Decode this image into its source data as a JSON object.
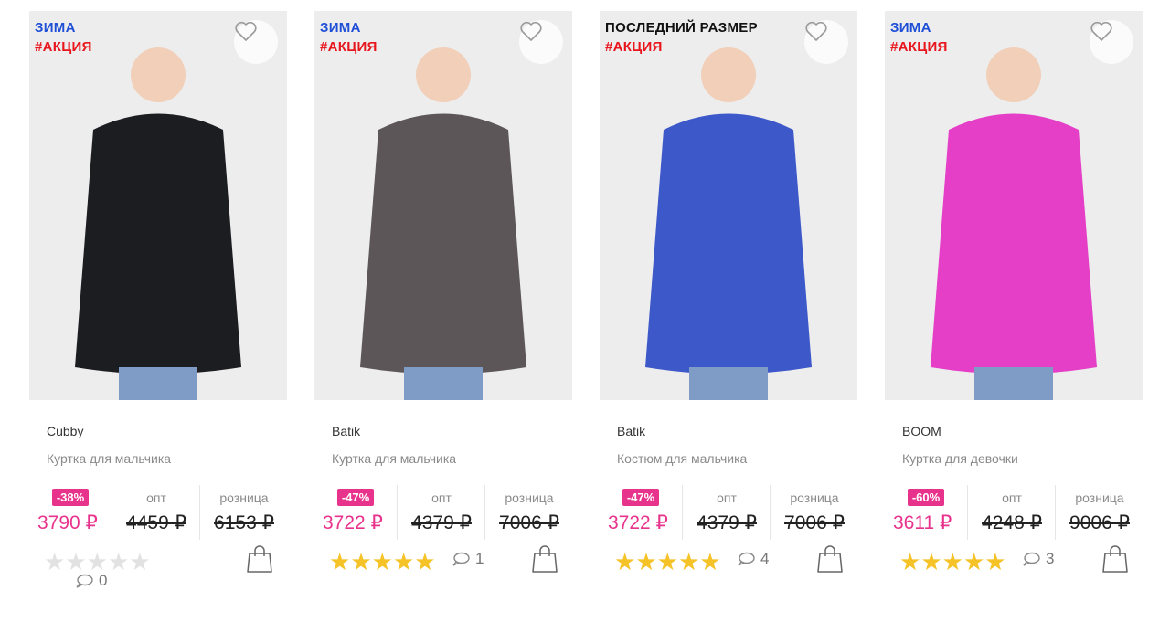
{
  "products": [
    {
      "labels": {
        "season": "ЗИМА",
        "promo": "#АКЦИЯ",
        "last": ""
      },
      "brand": "Cubby",
      "description": "Куртка для мальчика",
      "discount": "-38%",
      "price_now": "3790 ₽",
      "wholesale_label": "опт",
      "wholesale_price": "4459 ₽",
      "retail_label": "розница",
      "retail_price": "6153 ₽",
      "rating": 0,
      "comments": "0",
      "garment_color": "#1c1d20"
    },
    {
      "labels": {
        "season": "ЗИМА",
        "promo": "#АКЦИЯ",
        "last": ""
      },
      "brand": "Batik",
      "description": "Куртка для мальчика",
      "discount": "-47%",
      "price_now": "3722 ₽",
      "wholesale_label": "опт",
      "wholesale_price": "4379 ₽",
      "retail_label": "розница",
      "retail_price": "7006 ₽",
      "rating": 5,
      "comments": "1",
      "garment_color": "#5c5658"
    },
    {
      "labels": {
        "season": "",
        "promo": "#АКЦИЯ",
        "last": "ПОСЛЕДНИЙ РАЗМЕР"
      },
      "brand": "Batik",
      "description": "Костюм для мальчика",
      "discount": "-47%",
      "price_now": "3722 ₽",
      "wholesale_label": "опт",
      "wholesale_price": "4379 ₽",
      "retail_label": "розница",
      "retail_price": "7006 ₽",
      "rating": 5,
      "comments": "4",
      "garment_color": "#3d58c9"
    },
    {
      "labels": {
        "season": "ЗИМА",
        "promo": "#АКЦИЯ",
        "last": ""
      },
      "brand": "BOOM",
      "description": "Куртка для девочки",
      "discount": "-60%",
      "price_now": "3611 ₽",
      "wholesale_label": "опт",
      "wholesale_price": "4248 ₽",
      "retail_label": "розница",
      "retail_price": "9006 ₽",
      "rating": 5,
      "comments": "3",
      "garment_color": "#e43fc6"
    }
  ],
  "colors": {
    "accent_pink": "#e8338c",
    "promo_red": "#e8161d",
    "season_blue": "#1e4fd6",
    "star": "#f5c227"
  },
  "icons": {
    "favorite": "heart-outline-icon",
    "comment": "speech-bubble-icon",
    "cart": "shopping-bag-icon"
  }
}
